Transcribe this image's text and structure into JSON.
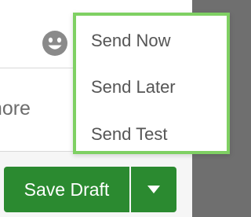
{
  "composer": {
    "emoji_icon": "smiley-face-icon",
    "more_partial_label": "more"
  },
  "footer": {
    "save_label": "Save Draft",
    "caret_icon": "caret-down-icon",
    "accent_color": "#2b8a30"
  },
  "send_menu": {
    "highlight_color": "#7fd063",
    "items": [
      {
        "label": "Send Now"
      },
      {
        "label": "Send Later"
      },
      {
        "label": "Send Test"
      }
    ]
  }
}
